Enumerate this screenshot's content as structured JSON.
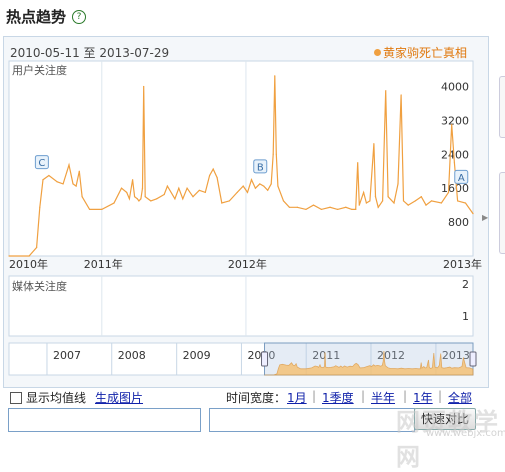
{
  "page": {
    "title": "热点趋势",
    "help_icon": "?"
  },
  "header": {
    "date_range": "2010-05-11 至 2013-07-29",
    "series_name": "黄家驹死亡真相"
  },
  "chart_data": [
    {
      "type": "line",
      "ylabel": "用户关注度",
      "x_ticks": [
        "2010年",
        "2011年",
        "2012年",
        "2013年"
      ],
      "y_ticks": [
        800,
        1600,
        2400,
        3200,
        4000
      ],
      "ylim": [
        0,
        4600
      ],
      "xlim": [
        "2010-05-11",
        "2013-07-29"
      ],
      "series": [
        {
          "name": "黄家驹死亡真相",
          "color": "#f0a040",
          "points": [
            [
              "2010-05-11",
              0
            ],
            [
              "2010-07-01",
              0
            ],
            [
              "2010-07-20",
              200
            ],
            [
              "2010-07-28",
              1150
            ],
            [
              "2010-08-05",
              1800
            ],
            [
              "2010-08-20",
              1900
            ],
            [
              "2010-09-10",
              1750
            ],
            [
              "2010-09-25",
              1700
            ],
            [
              "2010-10-10",
              2150
            ],
            [
              "2010-10-20",
              1700
            ],
            [
              "2010-10-28",
              1650
            ],
            [
              "2010-11-05",
              2000
            ],
            [
              "2010-11-12",
              1400
            ],
            [
              "2010-12-01",
              1100
            ],
            [
              "2011-01-01",
              1100
            ],
            [
              "2011-02-01",
              1250
            ],
            [
              "2011-02-20",
              1600
            ],
            [
              "2011-03-05",
              1500
            ],
            [
              "2011-03-12",
              1350
            ],
            [
              "2011-03-20",
              1800
            ],
            [
              "2011-03-25",
              1400
            ],
            [
              "2011-04-01",
              1350
            ],
            [
              "2011-04-05",
              1300
            ],
            [
              "2011-04-10",
              1350
            ],
            [
              "2011-04-14",
              1600
            ],
            [
              "2011-04-17",
              4000
            ],
            [
              "2011-04-21",
              1400
            ],
            [
              "2011-05-05",
              1300
            ],
            [
              "2011-05-20",
              1350
            ],
            [
              "2011-06-08",
              1450
            ],
            [
              "2011-06-16",
              1650
            ],
            [
              "2011-07-05",
              1350
            ],
            [
              "2011-07-15",
              1600
            ],
            [
              "2011-07-25",
              1350
            ],
            [
              "2011-08-05",
              1600
            ],
            [
              "2011-08-20",
              1400
            ],
            [
              "2011-09-05",
              1550
            ],
            [
              "2011-09-20",
              1500
            ],
            [
              "2011-10-01",
              1900
            ],
            [
              "2011-10-10",
              2050
            ],
            [
              "2011-10-20",
              1850
            ],
            [
              "2011-11-01",
              1250
            ],
            [
              "2011-11-20",
              1300
            ],
            [
              "2011-12-10",
              1500
            ],
            [
              "2011-12-25",
              1650
            ],
            [
              "2012-01-05",
              1500
            ],
            [
              "2012-01-10",
              1650
            ],
            [
              "2012-01-15",
              1800
            ],
            [
              "2012-01-25",
              1600
            ],
            [
              "2012-02-05",
              1700
            ],
            [
              "2012-02-15",
              1650
            ],
            [
              "2012-02-25",
              1550
            ],
            [
              "2012-03-05",
              1700
            ],
            [
              "2012-03-10",
              2400
            ],
            [
              "2012-03-14",
              4250
            ],
            [
              "2012-03-18",
              2400
            ],
            [
              "2012-03-22",
              1650
            ],
            [
              "2012-04-05",
              1300
            ],
            [
              "2012-04-20",
              1150
            ],
            [
              "2012-05-10",
              1150
            ],
            [
              "2012-06-01",
              1100
            ],
            [
              "2012-06-20",
              1200
            ],
            [
              "2012-07-10",
              1100
            ],
            [
              "2012-08-01",
              1150
            ],
            [
              "2012-08-20",
              1100
            ],
            [
              "2012-09-10",
              1150
            ],
            [
              "2012-09-25",
              1100
            ],
            [
              "2012-10-05",
              1100
            ],
            [
              "2012-10-10",
              2200
            ],
            [
              "2012-10-14",
              1200
            ],
            [
              "2012-10-25",
              1500
            ],
            [
              "2012-11-01",
              1250
            ],
            [
              "2012-11-10",
              1300
            ],
            [
              "2012-11-20",
              2650
            ],
            [
              "2012-11-24",
              1400
            ],
            [
              "2012-12-01",
              1150
            ],
            [
              "2012-12-12",
              1300
            ],
            [
              "2012-12-20",
              3900
            ],
            [
              "2012-12-26",
              1400
            ],
            [
              "2013-01-10",
              1250
            ],
            [
              "2013-01-20",
              1700
            ],
            [
              "2013-01-28",
              3800
            ],
            [
              "2013-02-03",
              1300
            ],
            [
              "2013-02-15",
              1200
            ],
            [
              "2013-03-05",
              1300
            ],
            [
              "2013-03-20",
              1400
            ],
            [
              "2013-04-01",
              1200
            ],
            [
              "2013-04-15",
              1300
            ],
            [
              "2013-05-10",
              1250
            ],
            [
              "2013-05-28",
              1500
            ],
            [
              "2013-06-05",
              3100
            ],
            [
              "2013-06-12",
              2200
            ],
            [
              "2013-06-20",
              1300
            ],
            [
              "2013-07-10",
              1250
            ],
            [
              "2013-07-29",
              1000
            ]
          ]
        }
      ],
      "annotations": [
        {
          "label": "C",
          "date": "2010-08-01",
          "value": 1850
        },
        {
          "label": "B",
          "date": "2012-02-05",
          "value": 1750
        },
        {
          "label": "A",
          "date": "2013-06-28",
          "value": 1500
        }
      ]
    },
    {
      "type": "line",
      "ylabel": "媒体关注度",
      "y_ticks": [
        1,
        2
      ],
      "series": []
    }
  ],
  "overview": {
    "years": [
      "2007",
      "2008",
      "2009",
      "2010",
      "2011",
      "2012",
      "2013"
    ],
    "selected_from": "2010-05-11",
    "selected_to": "2013-07-29"
  },
  "controls": {
    "show_average_label": "显示均值线",
    "average_checked": false,
    "generate_image_label": "生成图片",
    "time_width_label": "时间宽度：",
    "ranges": [
      "1月",
      "1季度",
      "半年",
      "1年",
      "全部"
    ],
    "compare_input_1_value": "",
    "compare_input_2_value": "",
    "compare_button_label": "快速对比"
  },
  "watermark": {
    "text": "网页教学网",
    "sub": "www.webjx.com"
  },
  "colors": {
    "series": "#f0a040",
    "fill": "#f6c070",
    "link": "#1122aa",
    "panel_border": "#c8d7e6"
  }
}
